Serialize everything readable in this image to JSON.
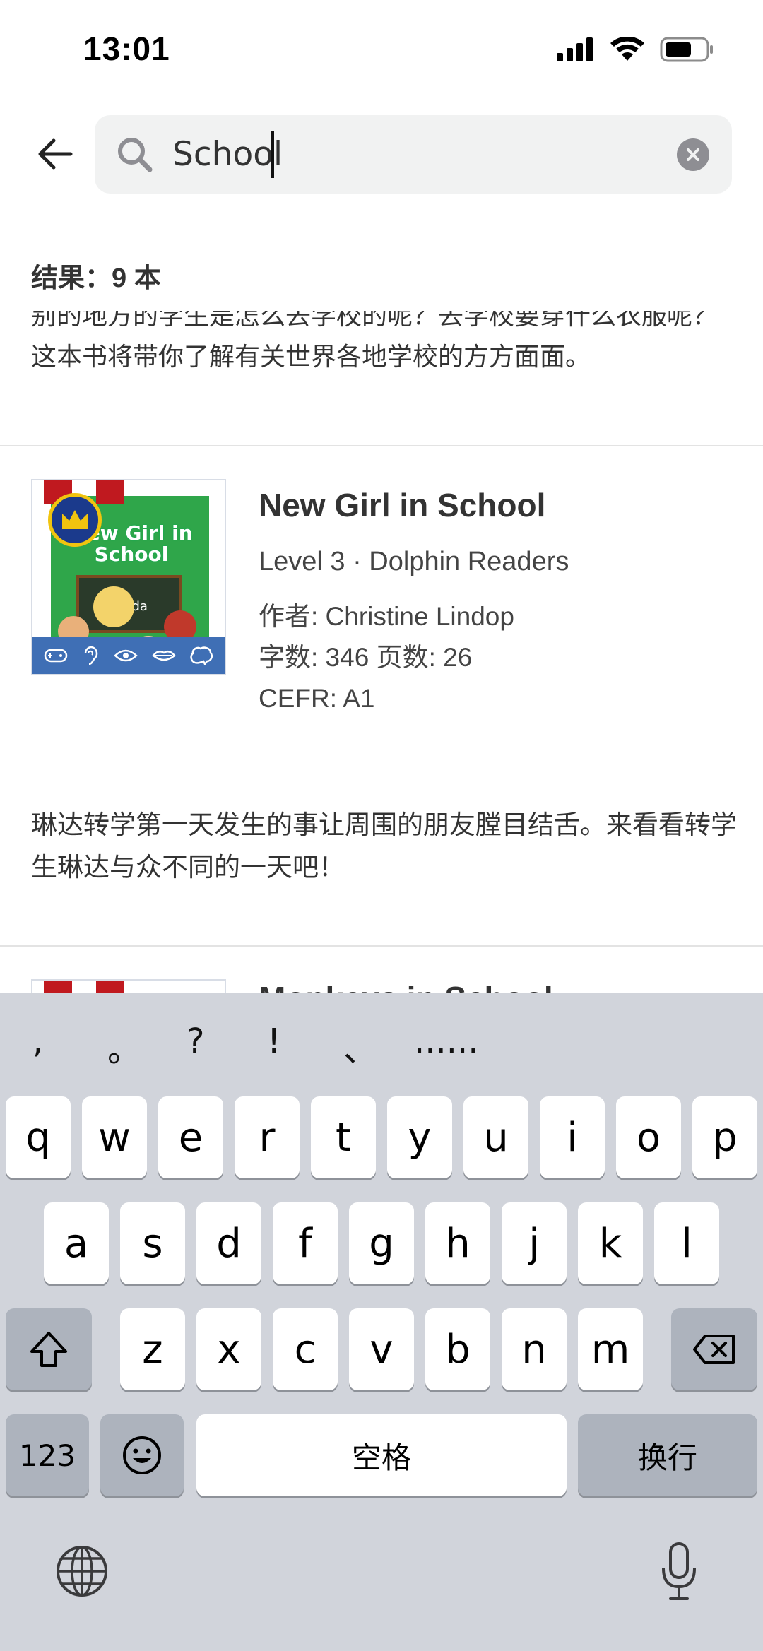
{
  "status": {
    "time": "13:01"
  },
  "search": {
    "query": "School",
    "placeholder": ""
  },
  "results": {
    "count_label": "结果：9 本"
  },
  "previous_description": "别的地方的学生是怎么去学校的呢？去学校要穿什么衣服呢？这本书将带你了解有关世界各地学校的方方面面。",
  "books": [
    {
      "title": "New Girl in School",
      "series": "Level 3 · Dolphin Readers",
      "author": "作者: Christine Lindop",
      "counts": "字数: 346   页数: 26",
      "cefr": "CEFR: A1",
      "description": "琳达转学第一天发生的事让周围的朋友膛目结舌。来看看转学生琳达与众不同的一天吧！",
      "cover_title": "New Girl in School",
      "cover_board_text": "Linda"
    }
  ],
  "next_book_title_partial": "Monkeys in School",
  "keyboard": {
    "punctuation": [
      ",",
      "。",
      "?",
      "!",
      "、",
      "......"
    ],
    "row1": [
      "q",
      "w",
      "e",
      "r",
      "t",
      "y",
      "u",
      "i",
      "o",
      "p"
    ],
    "row2": [
      "a",
      "s",
      "d",
      "f",
      "g",
      "h",
      "j",
      "k",
      "l"
    ],
    "row3": [
      "z",
      "x",
      "c",
      "v",
      "b",
      "n",
      "m"
    ],
    "numbers_label": "123",
    "space_label": "空格",
    "return_label": "换行"
  },
  "colors": {
    "accent_ribbon": "#c0191f",
    "cover_green": "#2fa64a",
    "cover_bar": "#3f6fb5",
    "keyboard_bg": "#d1d4db"
  }
}
